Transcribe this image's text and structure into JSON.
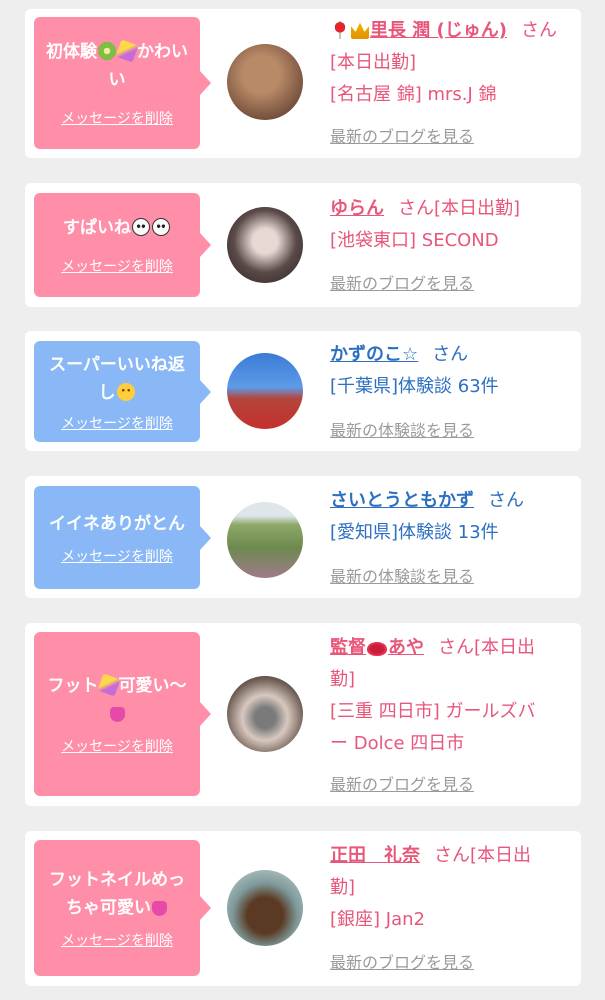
{
  "delete_label": "メッセージを削除",
  "items": [
    {
      "message_parts": [
        "初体験",
        "かわいい"
      ],
      "message_emoji": [
        "kiwi-icon",
        "sparkle-icon"
      ],
      "bubble_color": "#ff8fa9",
      "name": "里長 潤 (じゅん)",
      "name_prefix_icons": [
        "pin-icon",
        "crown-icon"
      ],
      "honorific": "さん",
      "status": "[本日出勤]",
      "location": "[名古屋 錦] mrs.J 錦",
      "link": "最新のブログを見る"
    },
    {
      "message_parts": [
        "すぱいね"
      ],
      "message_emoji": [
        "panda-icon",
        "panda-icon"
      ],
      "bubble_color": "#ff8fa9",
      "name": "ゆらん",
      "honorific": "さん",
      "status": "[本日出勤]",
      "location": "[池袋東口] SECOND",
      "link": "最新のブログを見る"
    },
    {
      "message_parts": [
        "スーパーいいね返",
        "し"
      ],
      "message_emoji": [
        "smile-icon"
      ],
      "bubble_color": "#8ab8f6",
      "name": "かずのこ☆",
      "honorific": "さん",
      "location": "[千葉県]体験談 63件",
      "link": "最新の体験談を見る"
    },
    {
      "message_parts": [
        "イイネありがとん"
      ],
      "bubble_color": "#8ab8f6",
      "name": "さいとうともかず",
      "honorific": "さん",
      "location": "[愛知県]体験談 13件",
      "link": "最新の体験談を見る"
    },
    {
      "message_parts": [
        "フット",
        "可愛い〜"
      ],
      "message_emoji": [
        "sparkle-icon",
        "heart-icon"
      ],
      "bubble_color": "#ff8fa9",
      "name_parts": [
        "監督",
        "あや"
      ],
      "name_emoji": [
        "lips-icon"
      ],
      "honorific": "さん",
      "status_parts": [
        "[本日出",
        "勤]"
      ],
      "location_parts": [
        "[三重 四日市] ガールズバ",
        "ー Dolce 四日市"
      ],
      "link": "最新のブログを見る"
    },
    {
      "message_parts": [
        "フットネイルめっ",
        "ちゃ可愛い"
      ],
      "message_emoji": [
        "heart-icon"
      ],
      "bubble_color": "#ff8fa9",
      "name": "正田　礼奈",
      "honorific": "さん",
      "status_parts": [
        "[本日出",
        "勤]"
      ],
      "location": "[銀座] Jan2",
      "link": "最新のブログを見る"
    }
  ]
}
